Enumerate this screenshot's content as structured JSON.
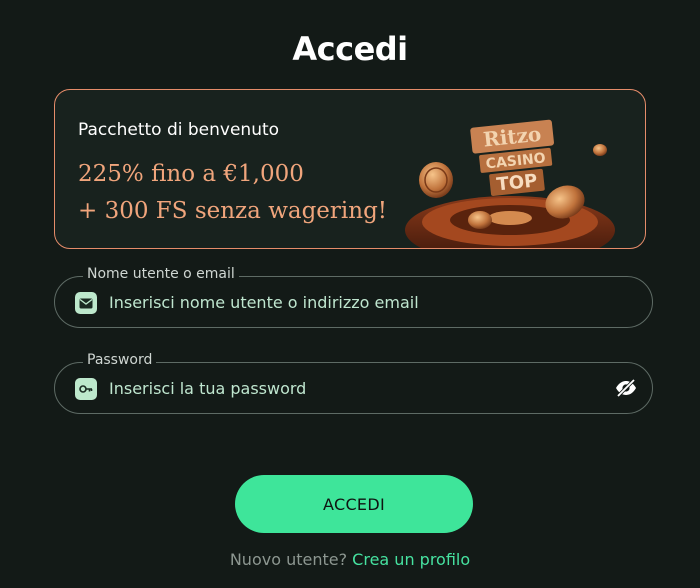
{
  "page": {
    "title": "Accedi"
  },
  "promo": {
    "heading": "Pacchetto di benvenuto",
    "line1": "225% fino a €1,000",
    "line2": "+ 300 FS senza wagering!",
    "image_icon": "casino-logo-with-coins-and-roulette",
    "border_color": "#e58c6a",
    "text_color": "#f0a57c"
  },
  "username_field": {
    "label": "Nome utente o email",
    "placeholder": "Inserisci nome utente o indirizzo email",
    "value": "",
    "icon": "envelope-icon"
  },
  "password_field": {
    "label": "Password",
    "placeholder": "Inserisci la tua password",
    "value": "",
    "icon": "key-icon",
    "toggle_icon": "eye-slash-icon"
  },
  "submit": {
    "label": "ACCEDI",
    "color": "#3ee59a"
  },
  "signup": {
    "prompt": "Nuovo utente?",
    "link": "Crea un profilo",
    "link_color": "#46e2a0"
  },
  "colors": {
    "background": "#131a17",
    "accent": "#3ee59a"
  }
}
